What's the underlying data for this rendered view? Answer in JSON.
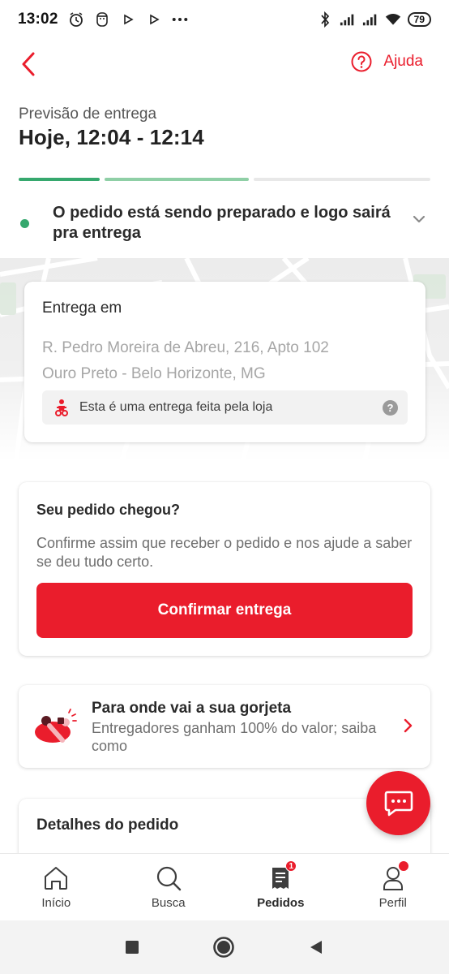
{
  "status_bar": {
    "time": "13:02",
    "left_icons": [
      "alarm-icon",
      "face-icon",
      "play-icon",
      "play-icon",
      "more-icon"
    ],
    "right_icons": [
      "bluetooth-icon",
      "signal-icon",
      "signal-icon",
      "wifi-icon"
    ],
    "battery": "79"
  },
  "header": {
    "back_icon": "chevron-left-icon",
    "help_label": "Ajuda",
    "help_icon": "question-circle-icon"
  },
  "forecast": {
    "label": "Previsão de entrega",
    "value": "Hoje, 12:04 - 12:14"
  },
  "progress": {
    "steps": [
      {
        "state": "complete",
        "color": "#36a86e"
      },
      {
        "state": "current",
        "color": "#8fcfa6"
      },
      {
        "state": "pending",
        "color": "#e8e8e8"
      }
    ]
  },
  "order_status": {
    "text": "O pedido está sendo preparado e logo sairá pra entrega",
    "dot_color": "#36a86e"
  },
  "delivery": {
    "title": "Entrega em",
    "address_line1": "R. Pedro Moreira de Abreu, 216, Apto 102",
    "address_line2": "Ouro Preto - Belo Horizonte, MG",
    "store_note": "Esta é uma entrega feita pela loja",
    "store_note_help": "?"
  },
  "arrived": {
    "title": "Seu pedido chegou?",
    "description": "Confirme assim que receber o pedido e nos ajude a saber se deu tudo certo.",
    "button": "Confirmar entrega"
  },
  "tip": {
    "title": "Para onde vai a sua gorjeta",
    "description": "Entregadores ganham 100% do valor; saiba como"
  },
  "details": {
    "title": "Detalhes do pedido"
  },
  "bottom_nav": {
    "items": [
      {
        "label": "Início",
        "icon": "home-icon"
      },
      {
        "label": "Busca",
        "icon": "search-icon"
      },
      {
        "label": "Pedidos",
        "icon": "orders-icon",
        "badge": "1",
        "active": true
      },
      {
        "label": "Perfil",
        "icon": "profile-icon"
      }
    ]
  },
  "colors": {
    "brand_red": "#ea1d2c",
    "success_green": "#36a86e"
  }
}
